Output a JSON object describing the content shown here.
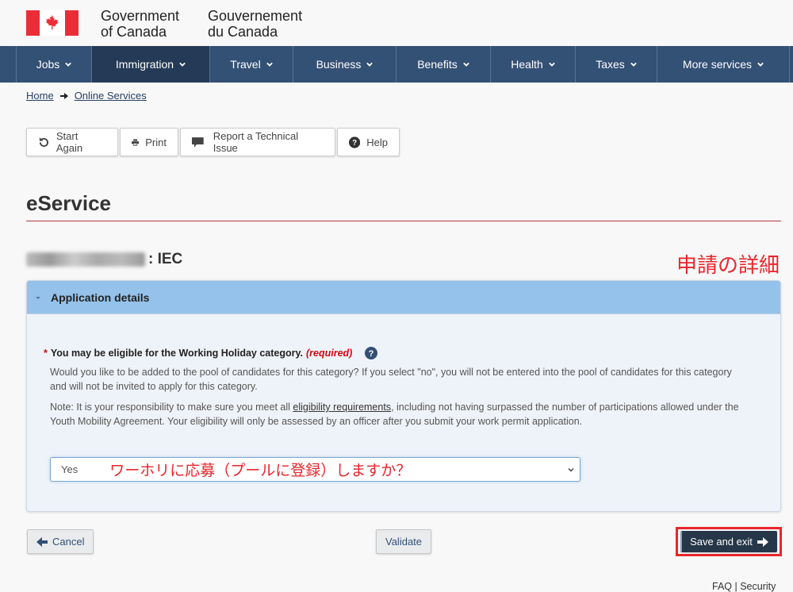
{
  "header": {
    "signature_en_line1": "Government",
    "signature_en_line2": "of Canada",
    "signature_fr_line1": "Gouvernement",
    "signature_fr_line2": "du Canada",
    "flag_color": "#eb2d37"
  },
  "nav": {
    "items": [
      {
        "label": "Jobs",
        "active": false
      },
      {
        "label": "Immigration",
        "active": true
      },
      {
        "label": "Travel",
        "active": false
      },
      {
        "label": "Business",
        "active": false
      },
      {
        "label": "Benefits",
        "active": false
      },
      {
        "label": "Health",
        "active": false
      },
      {
        "label": "Taxes",
        "active": false
      },
      {
        "label": "More services",
        "active": false
      }
    ],
    "background": "#335075"
  },
  "breadcrumb": {
    "items": [
      "Home",
      "Online Services"
    ]
  },
  "toolbar": {
    "start_again": "Start Again",
    "print": "Print",
    "report": "Report a Technical Issue",
    "help": "Help"
  },
  "page": {
    "title": "eService",
    "application_suffix": ": IEC",
    "annotation_heading": "申請の詳細"
  },
  "panel": {
    "title": "Application details",
    "question": {
      "required_mark": "*",
      "label": "You may be eligible for the Working Holiday category.",
      "required_text": "(required)",
      "description_1": "Would you like to be added to the pool of candidates for this category? If you select \"no\", you will not be entered into the pool of candidates for this category and will not be invited to apply for this category.",
      "note_prefix": "Note: It is your responsibility to make sure you meet all ",
      "note_link": "eligibility requirements",
      "note_suffix": ", including not having surpassed the number of participations allowed under the Youth Mobility Agreement. Your eligibility will only be assessed by an officer after you submit your work permit application."
    },
    "select": {
      "value": "Yes",
      "annotation": "ワーホリに応募（プールに登録）しますか？"
    }
  },
  "actions": {
    "cancel": "Cancel",
    "validate": "Validate",
    "save_exit": "Save and exit"
  },
  "footer": {
    "links": "FAQ | Security"
  }
}
